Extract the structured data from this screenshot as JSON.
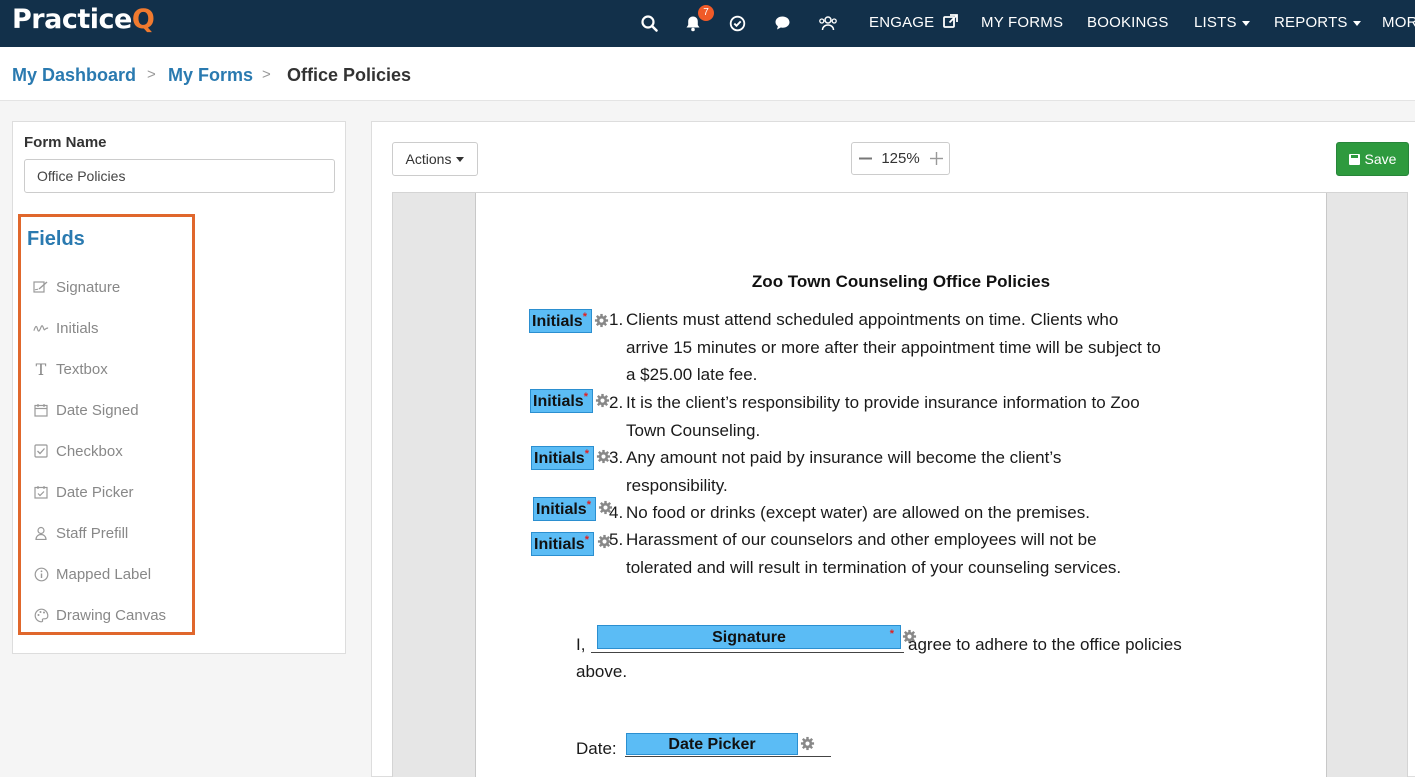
{
  "app": {
    "logo_main": "Practice",
    "logo_accent": "Q"
  },
  "nav": {
    "notification_count": "7",
    "links": [
      "ENGAGE",
      "MY FORMS",
      "BOOKINGS",
      "LISTS",
      "REPORTS",
      "MOR"
    ],
    "icons": [
      "search-icon",
      "bell-icon",
      "check-circle-icon",
      "chat-icon",
      "users-icon",
      "external-link-icon"
    ]
  },
  "breadcrumb": {
    "items": [
      "My Dashboard",
      "My Forms",
      "Office Policies"
    ],
    "separator": ">"
  },
  "left_panel": {
    "form_name_label": "Form Name",
    "form_name_value": "Office Policies",
    "fields_title": "Fields",
    "fields": [
      {
        "label": "Signature",
        "icon": "signature-icon"
      },
      {
        "label": "Initials",
        "icon": "initials-icon"
      },
      {
        "label": "Textbox",
        "icon": "textbox-icon"
      },
      {
        "label": "Date Signed",
        "icon": "calendar-icon"
      },
      {
        "label": "Checkbox",
        "icon": "checkbox-icon"
      },
      {
        "label": "Date Picker",
        "icon": "date-picker-icon"
      },
      {
        "label": "Staff Prefill",
        "icon": "staff-icon"
      },
      {
        "label": "Mapped Label",
        "icon": "info-icon"
      },
      {
        "label": "Drawing Canvas",
        "icon": "palette-icon"
      }
    ]
  },
  "toolbar": {
    "actions_label": "Actions",
    "zoom_value": "125%",
    "save_label": "Save"
  },
  "document": {
    "title": "Zoo Town Counseling Office Policies",
    "policies": [
      {
        "num": "1.",
        "lines": [
          "Clients must attend scheduled appointments on time. Clients who",
          "arrive 15 minutes or more after their appointment time will be subject to",
          "a $25.00 late fee."
        ]
      },
      {
        "num": "2.",
        "lines": [
          "It is the client’s responsibility to provide insurance information to Zoo",
          "Town Counseling."
        ]
      },
      {
        "num": "3.",
        "lines": [
          "Any amount not paid by insurance will become the client’s",
          "responsibility."
        ]
      },
      {
        "num": "4.",
        "lines": [
          "No food or drinks (except water) are allowed on the premises."
        ]
      },
      {
        "num": "5.",
        "lines": [
          "Harassment of our counselors and other employees will not be",
          "tolerated and will result in termination of your counseling services."
        ]
      }
    ],
    "initials_field_label": "Initials",
    "required_mark": "*",
    "agree_prefix": "I,",
    "agree_line1": "agree to adhere to the office policies",
    "agree_line2": "above.",
    "signature_field_label": "Signature",
    "date_label": "Date:",
    "date_field_label": "Date Picker",
    "field_color": "#5bbcf5"
  }
}
